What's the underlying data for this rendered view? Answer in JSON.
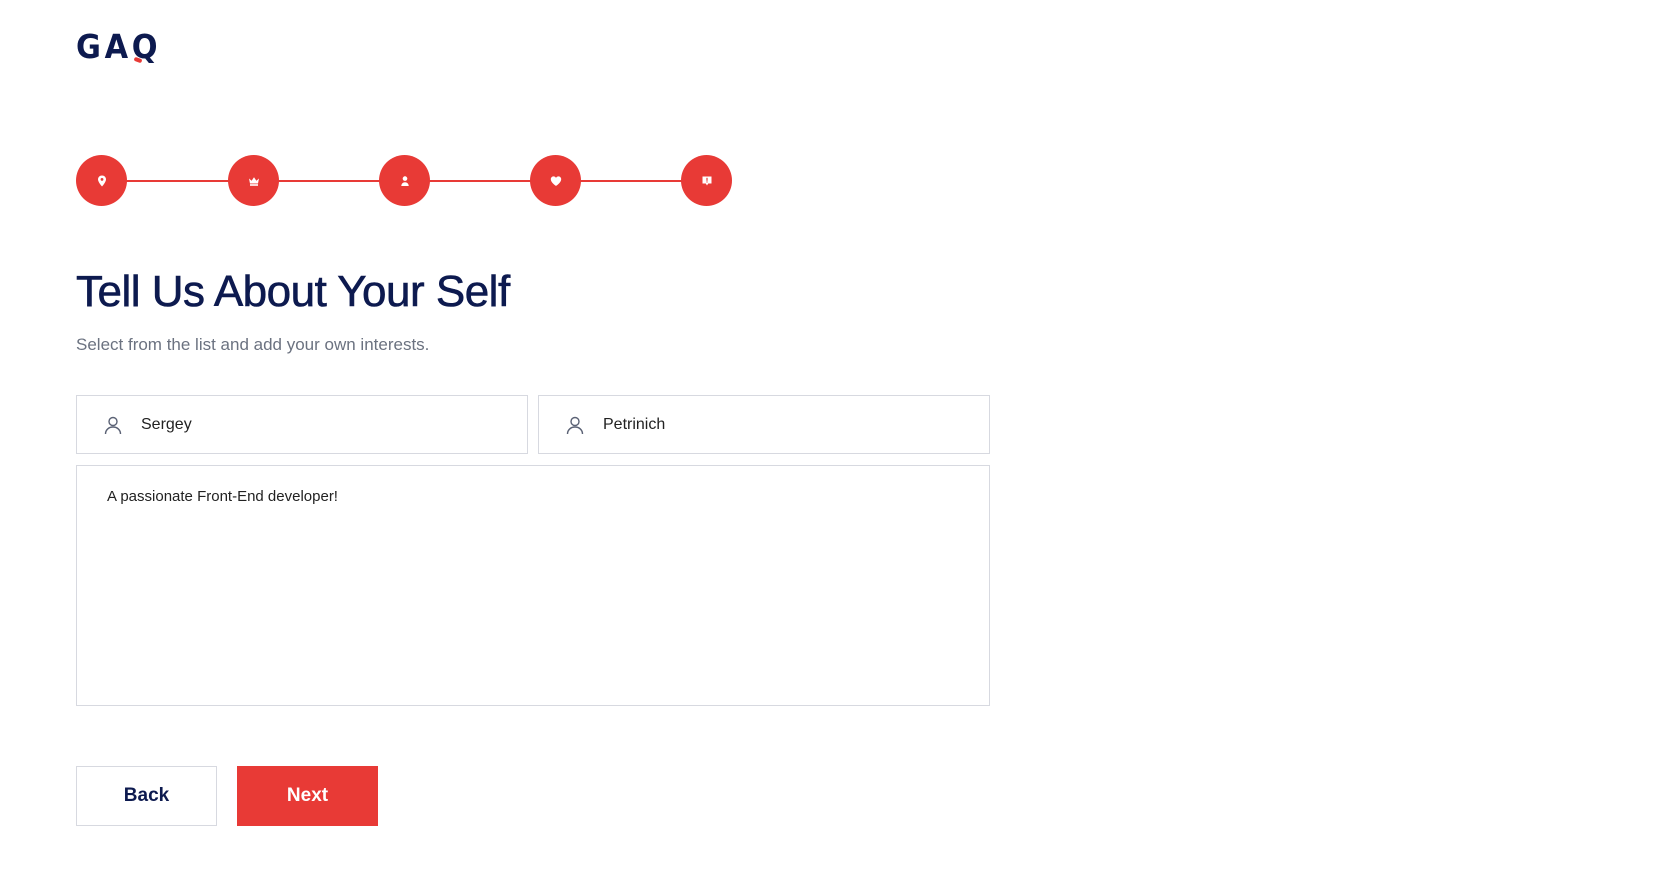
{
  "brand": {
    "logo_text": "GAQ",
    "accent_color": "#e83a36",
    "primary_color": "#0d1a4f"
  },
  "steps": [
    {
      "icon": "location-pin-icon"
    },
    {
      "icon": "crown-icon"
    },
    {
      "icon": "user-icon"
    },
    {
      "icon": "heart-icon"
    },
    {
      "icon": "badge-icon"
    }
  ],
  "header": {
    "title": "Tell Us About Your Self",
    "subtitle": "Select from the list and add your own interests."
  },
  "form": {
    "first_name": {
      "value": "Sergey",
      "icon": "user-icon"
    },
    "last_name": {
      "value": "Petrinich",
      "icon": "user-icon"
    },
    "bio": {
      "value": "A passionate Front-End developer!"
    }
  },
  "actions": {
    "back_label": "Back",
    "next_label": "Next"
  }
}
